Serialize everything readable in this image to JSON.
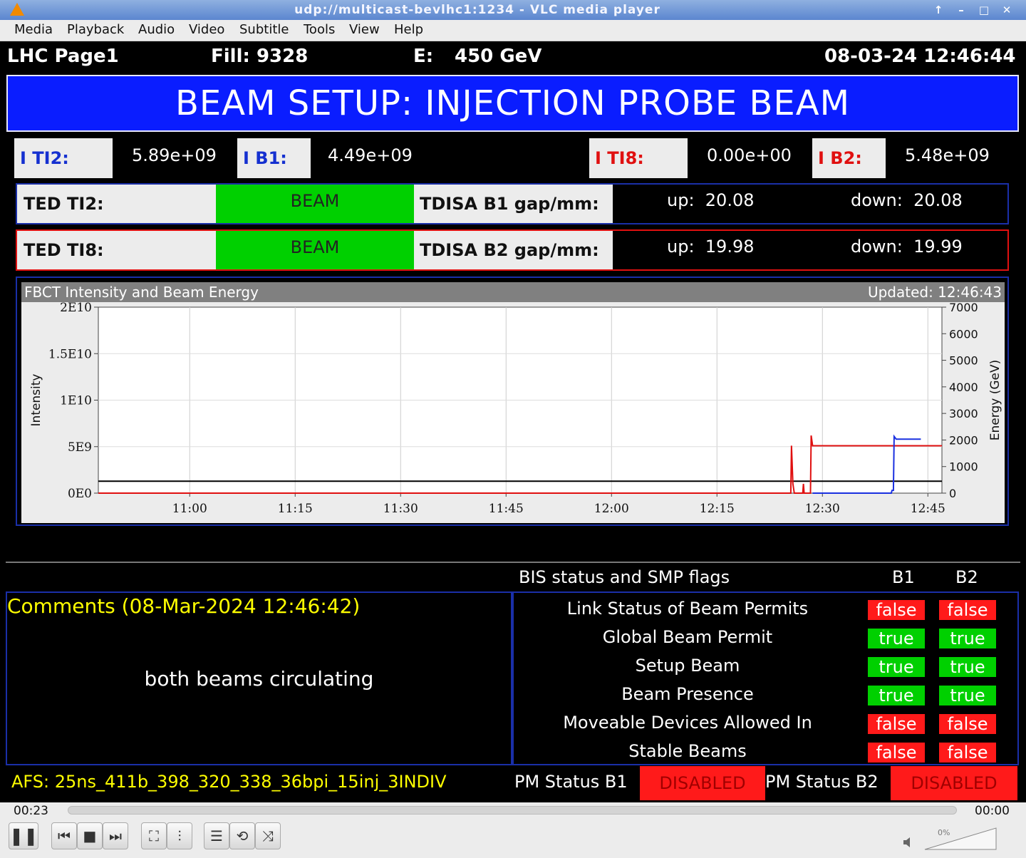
{
  "window": {
    "title": "udp://multicast-bevlhc1:1234 - VLC media player",
    "buttons": [
      "↑",
      "–",
      "□",
      "✕"
    ]
  },
  "menu": [
    "Media",
    "Playback",
    "Audio",
    "Video",
    "Subtitle",
    "Tools",
    "View",
    "Help"
  ],
  "header": {
    "page": "LHC Page1",
    "fill": "Fill: 9328",
    "energy_label": "E:",
    "energy_value": "450 GeV",
    "datetime": "08-03-24 12:46:44"
  },
  "banner": "BEAM SETUP: INJECTION PROBE BEAM",
  "intensities": [
    {
      "label": "I TI2:",
      "value": "5.89e+09",
      "color": "#1530d0"
    },
    {
      "label": "I B1:",
      "value": "4.49e+09",
      "color": "#1530d0"
    },
    {
      "label": "I TI8:",
      "value": "0.00e+00",
      "color": "#e01010"
    },
    {
      "label": "I B2:",
      "value": "5.48e+09",
      "color": "#e01010"
    }
  ],
  "ted": [
    {
      "label": "TED TI2:",
      "state": "BEAM",
      "gap_label": "TDISA B1 gap/mm:",
      "up": "up:  20.08",
      "down": "down:  20.08",
      "border": "#1a2fa8"
    },
    {
      "label": "TED TI8:",
      "state": "BEAM",
      "gap_label": "TDISA B2 gap/mm:",
      "up": "up:  19.98",
      "down": "down:  19.99",
      "border": "#e01010"
    }
  ],
  "chart_header": {
    "title": "FBCT Intensity and Beam Energy",
    "updated": "Updated: 12:46:43"
  },
  "chart_data": {
    "type": "line",
    "ylabel": "Intensity",
    "y2label": "Energy (GeV)",
    "x_ticks": [
      "11:00",
      "11:15",
      "11:30",
      "11:45",
      "12:00",
      "12:15",
      "12:30",
      "12:45"
    ],
    "y_ticks": [
      "0E0",
      "5E9",
      "1E10",
      "1.5E10",
      "2E10"
    ],
    "y2_ticks": [
      "0",
      "1000",
      "2000",
      "3000",
      "4000",
      "5000",
      "6000",
      "7000"
    ],
    "ylim": [
      0,
      20000000000.0
    ],
    "y2lim": [
      0,
      7000
    ],
    "xlim_minutes": [
      647,
      767
    ],
    "grid": true,
    "series": [
      {
        "axis": "y2",
        "color": "#000000",
        "points": [
          [
            647,
            450
          ],
          [
            767,
            450
          ]
        ]
      },
      {
        "axis": "y",
        "color": "#e01010",
        "points": [
          [
            647,
            0
          ],
          [
            745.5,
            0
          ],
          [
            745.6,
            5100000000.0
          ],
          [
            745.8,
            1000000000.0
          ],
          [
            746,
            0
          ],
          [
            747.2,
            0
          ],
          [
            747.3,
            1000000000.0
          ],
          [
            747.4,
            0
          ],
          [
            748.3,
            0
          ],
          [
            748.4,
            6200000000.0
          ],
          [
            748.6,
            5100000000.0
          ],
          [
            767,
            5100000000.0
          ]
        ]
      },
      {
        "axis": "y",
        "color": "#1a30e0",
        "points": [
          [
            748.6,
            0
          ],
          [
            759.8,
            0
          ],
          [
            759.9,
            300000000.0
          ],
          [
            760.1,
            300000000.0
          ],
          [
            760.2,
            6100000000.0
          ],
          [
            760.5,
            5800000000.0
          ],
          [
            764,
            5800000000.0
          ]
        ]
      }
    ]
  },
  "bis": {
    "title": "BIS status and SMP flags",
    "col_b1": "B1",
    "col_b2": "B2",
    "rows": [
      {
        "label": "Link Status of Beam Permits",
        "b1": "false",
        "b2": "false"
      },
      {
        "label": "Global Beam Permit",
        "b1": "true",
        "b2": "true"
      },
      {
        "label": "Setup Beam",
        "b1": "true",
        "b2": "true"
      },
      {
        "label": "Beam Presence",
        "b1": "true",
        "b2": "true"
      },
      {
        "label": "Moveable Devices Allowed In",
        "b1": "false",
        "b2": "false"
      },
      {
        "label": "Stable Beams",
        "b1": "false",
        "b2": "false"
      }
    ]
  },
  "comments": {
    "title": "Comments (08-Mar-2024 12:46:42)",
    "body": "both beams circulating"
  },
  "footer": {
    "afs": "AFS: 25ns_411b_398_320_338_36bpi_15inj_3INDIV",
    "pm_b1_label": "PM Status B1",
    "pm_b1_value": "DISABLED",
    "pm_b2_label": "PM Status B2",
    "pm_b2_value": "DISABLED"
  },
  "player": {
    "elapsed": "00:23",
    "remaining": "00:00",
    "progress": 0,
    "volume": "0%"
  }
}
